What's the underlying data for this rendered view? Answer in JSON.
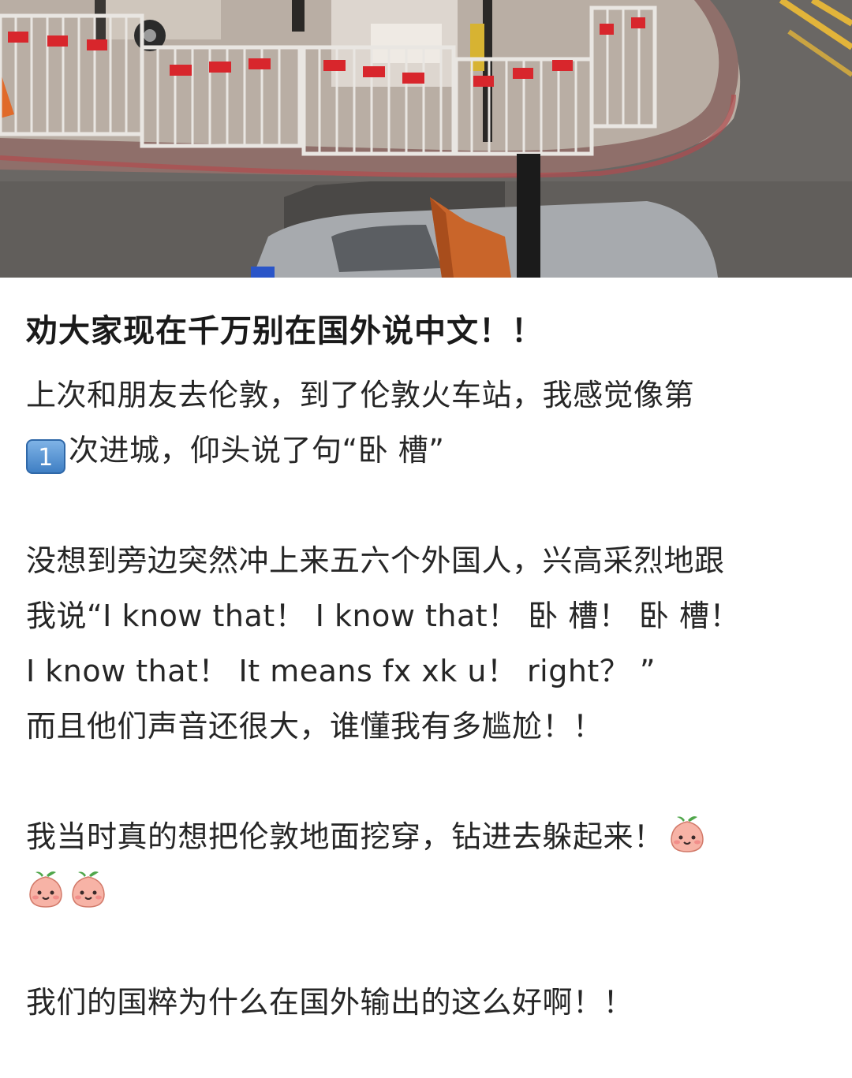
{
  "post": {
    "title": "劝大家现在千万别在国外说中文！！",
    "paragraph1": {
      "line1": "上次和朋友去伦敦，到了伦敦火车站，我感觉像第",
      "line2_badge": "1",
      "line2_text": "次进城，仰头说了句“卧 槽”"
    },
    "paragraph2": {
      "line1": "没想到旁边突然冲上来五六个外国人，兴高采烈地跟",
      "line2": "我说“I know that！ I know that！ 卧 槽！ 卧 槽！",
      "line3": "I know that！ It means fx xk u！ right？ ”",
      "line4": "而且他们声音还很大，谁懂我有多尴尬！！"
    },
    "paragraph3": {
      "line1": "我当时真的想把伦敦地面挖穿，钻进去躲起来！",
      "emoji_icon": "peach-face-icon"
    },
    "paragraph4": {
      "line1": "我们的国粹为什么在国外输出的这么好啊！！"
    }
  },
  "colors": {
    "text": "#262626",
    "title": "#1a1a1a",
    "keycap": "#3f7fc4",
    "barrier_red": "#d8262c",
    "road": "#5e5c5a"
  }
}
